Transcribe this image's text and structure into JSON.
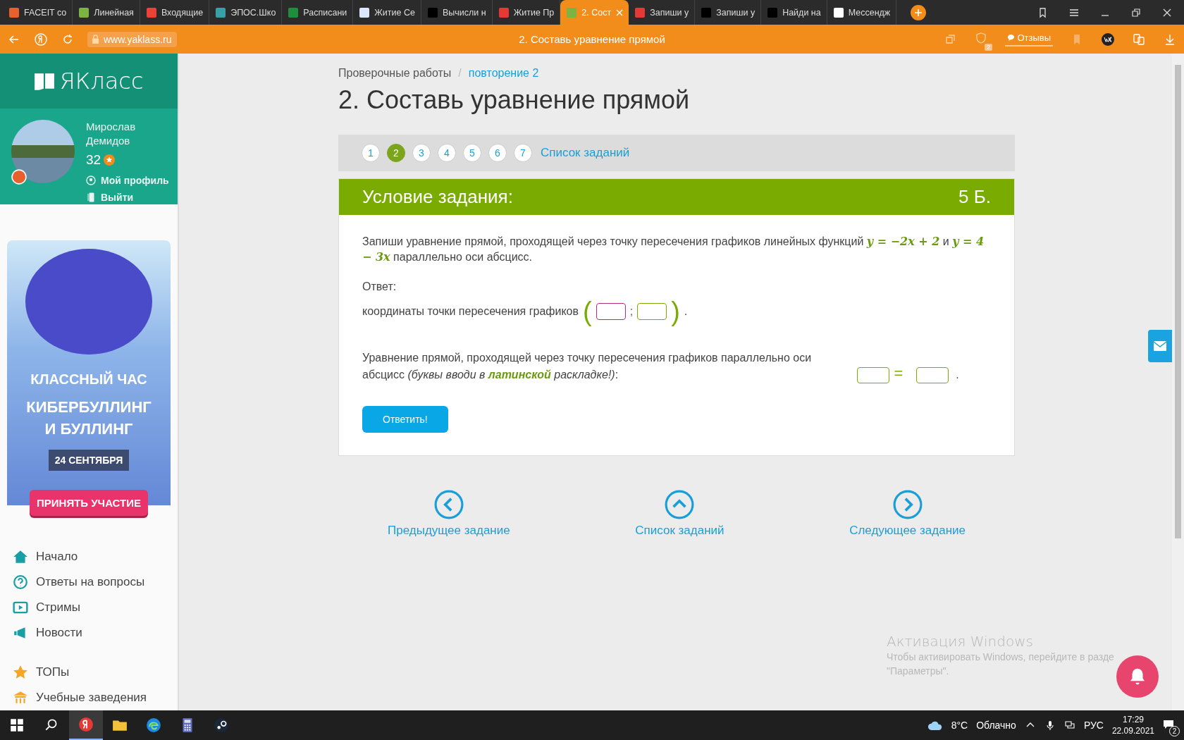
{
  "browser": {
    "tabs": [
      {
        "title": "FACEIT co",
        "kind": "faceit",
        "selected": false
      },
      {
        "title": "Линейная",
        "kind": "book",
        "selected": false
      },
      {
        "title": "Входящие",
        "kind": "mail",
        "selected": false
      },
      {
        "title": "ЭПОС.Шко",
        "kind": "drop",
        "selected": false
      },
      {
        "title": "Расписани",
        "kind": "sheet",
        "selected": false
      },
      {
        "title": "Житие Се",
        "kind": "shield",
        "selected": false
      },
      {
        "title": "Вычисли н",
        "kind": "znanija",
        "selected": false
      },
      {
        "title": "Житие Пр",
        "kind": "red",
        "selected": false
      },
      {
        "title": "2. Сост",
        "kind": "book",
        "selected": true
      },
      {
        "title": "Запиши у",
        "kind": "yandex",
        "selected": false
      },
      {
        "title": "Запиши у",
        "kind": "znanija",
        "selected": false
      },
      {
        "title": "Найди на",
        "kind": "znanija",
        "selected": false
      },
      {
        "title": "Мессендж",
        "kind": "chat",
        "selected": false
      }
    ],
    "url": "www.yaklass.ru",
    "page_title": "2. Составь уравнение прямой",
    "feedback": "Отзывы",
    "badge": "2"
  },
  "sidebar": {
    "logo": "ЯКласс",
    "user": {
      "name": "Мирослав Демидов",
      "points": "32",
      "links": [
        {
          "label": "Мой профиль",
          "kind": "profile"
        },
        {
          "label": "Выйти",
          "kind": "exit"
        }
      ]
    },
    "ad": {
      "line1": "КЛАССНЫЙ ЧАС",
      "line2": "КИБЕРБУЛЛИНГ И БУЛЛИНГ",
      "date": "24 СЕНТЯБРЯ",
      "button": "ПРИНЯТЬ УЧАСТИЕ"
    },
    "menu": [
      {
        "label": "Начало",
        "kind": "home"
      },
      {
        "label": "Ответы на вопросы",
        "kind": "question"
      },
      {
        "label": "Стримы",
        "kind": "stream"
      },
      {
        "label": "Новости",
        "kind": "news"
      },
      {
        "label": "ТОПы",
        "kind": "star"
      },
      {
        "label": "Учебные заведения",
        "kind": "school"
      }
    ]
  },
  "breadcrumbs": [
    {
      "label": "Проверочные работы",
      "link": false
    },
    {
      "label": "повторение 2",
      "link": true
    }
  ],
  "breadcrumb_separator": "/",
  "heading": "2. Составь уравнение прямой",
  "steps": [
    {
      "label": "1",
      "selected": false
    },
    {
      "label": "2",
      "selected": true
    },
    {
      "label": "3",
      "selected": false
    },
    {
      "label": "4",
      "selected": false
    },
    {
      "label": "5",
      "selected": false
    },
    {
      "label": "6",
      "selected": false
    },
    {
      "label": "7",
      "selected": false
    }
  ],
  "task_list_link": "Список заданий",
  "task": {
    "title": "Условие задания:",
    "points": "5 Б.",
    "statement": "Запиши уравнение прямой, проходящей через точку пересечения графиков линейных функций *y = −2x + 2* и *y = 4 − 3x* параллельно оси абсцисс.",
    "answer_label": "Ответ:",
    "coords_label": "координаты точки пересечения графиков",
    "open_paren": "(",
    "separator": ";",
    "close_paren": ")",
    "end_dot": ".",
    "coord_fields": [
      {
        "focused": true
      },
      {
        "focused": false
      }
    ],
    "equation_label": "Уравнение прямой, проходящей через точку пересечения графиков параллельно оси абсцисс *(буквы вводи в* **латинской** *раскладке!)*:",
    "equation_fields": [
      {
        "focused": false
      },
      {
        "focused": false
      }
    ],
    "equals": "=",
    "equation_end": ".",
    "submit": "Ответить!"
  },
  "nav": [
    {
      "label": "Предыдущее задание",
      "kind": "prev"
    },
    {
      "label": "Список заданий",
      "kind": "up"
    },
    {
      "label": "Следующее задание",
      "kind": "next"
    }
  ],
  "activation": {
    "title": "Активация Windows",
    "text": "Чтобы активировать Windows, перейдите в разде",
    "text2": "\"Параметры\"."
  },
  "taskbar": {
    "weather": "8°C",
    "condition": "Облачно",
    "lang": "РУС",
    "time": "17:29",
    "date": "22.09.2021",
    "notifications": "2"
  }
}
